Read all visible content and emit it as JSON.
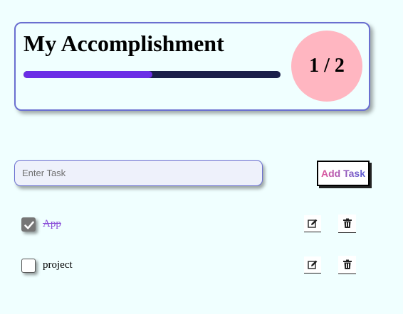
{
  "summary": {
    "title": "My Accomplishment",
    "progress_fraction": 0.5,
    "count_label": "1 / 2"
  },
  "form": {
    "input_placeholder": "Enter Task",
    "input_value": "",
    "add_button_label": "Add Task"
  },
  "tasks": [
    {
      "label": "App",
      "completed": true
    },
    {
      "label": "project",
      "completed": false
    }
  ],
  "colors": {
    "background": "#f0ffff",
    "card_border": "#6a6fd0",
    "progress_track": "#1a1f4a",
    "progress_fill": "#6b2ee6",
    "count_circle": "#ffb6c1",
    "completed_text": "#8a4fd8",
    "button_gradient_start": "#e0559b",
    "button_gradient_end": "#5a5fd6"
  },
  "icons": {
    "edit": "edit-icon",
    "delete": "trash-icon",
    "check": "check-icon"
  }
}
